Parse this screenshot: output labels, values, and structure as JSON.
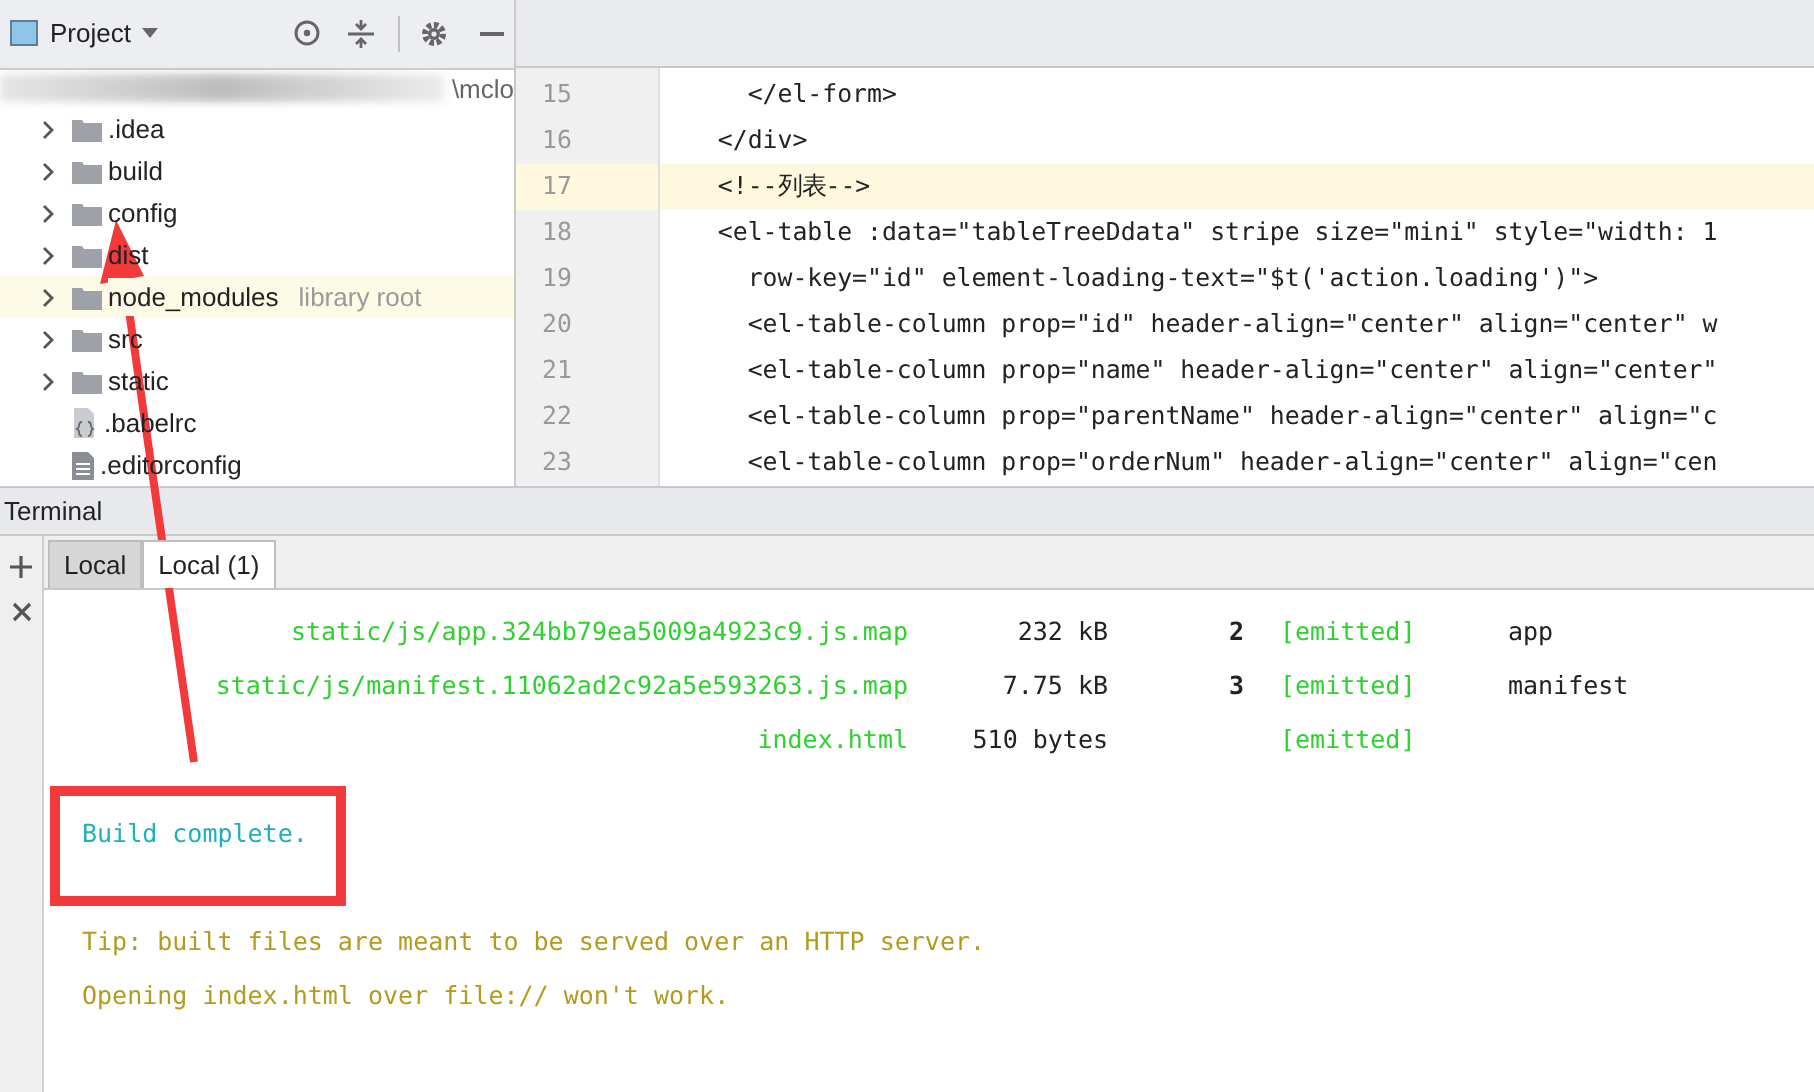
{
  "project_panel": {
    "title": "Project",
    "path_tail": "\\mclo",
    "tree": [
      {
        "label": ".idea",
        "kind": "folder",
        "highlighted": false
      },
      {
        "label": "build",
        "kind": "folder",
        "highlighted": false
      },
      {
        "label": "config",
        "kind": "folder",
        "highlighted": false
      },
      {
        "label": "dist",
        "kind": "folder",
        "highlighted": false
      },
      {
        "label": "node_modules",
        "kind": "folder",
        "hint": "library root",
        "highlighted": true
      },
      {
        "label": "src",
        "kind": "folder",
        "highlighted": false
      },
      {
        "label": "static",
        "kind": "folder",
        "highlighted": false
      },
      {
        "label": ".babelrc",
        "kind": "config-file",
        "highlighted": false
      },
      {
        "label": ".editorconfig",
        "kind": "text-file",
        "highlighted": false
      }
    ]
  },
  "editor": {
    "lines": [
      {
        "number": "15",
        "code": "    </el-form>",
        "highlighted": false
      },
      {
        "number": "16",
        "code": "  </div>",
        "highlighted": false
      },
      {
        "number": "17",
        "code": "  <!--列表-->",
        "highlighted": true
      },
      {
        "number": "18",
        "code": "  <el-table :data=\"tableTreeDdata\" stripe size=\"mini\" style=\"width: 1",
        "highlighted": false
      },
      {
        "number": "19",
        "code": "    row-key=\"id\" element-loading-text=\"$t('action.loading')\">",
        "highlighted": false
      },
      {
        "number": "20",
        "code": "    <el-table-column prop=\"id\" header-align=\"center\" align=\"center\" w",
        "highlighted": false
      },
      {
        "number": "21",
        "code": "    <el-table-column prop=\"name\" header-align=\"center\" align=\"center\"",
        "highlighted": false
      },
      {
        "number": "22",
        "code": "    <el-table-column prop=\"parentName\" header-align=\"center\" align=\"c",
        "highlighted": false
      },
      {
        "number": "23",
        "code": "    <el-table-column prop=\"orderNum\" header-align=\"center\" align=\"cen",
        "highlighted": false
      }
    ]
  },
  "terminal": {
    "title": "Terminal",
    "tabs": [
      {
        "label": "Local",
        "selected": false
      },
      {
        "label": "Local (1)",
        "selected": true
      }
    ],
    "assets": [
      {
        "file": "static/js/app.324bb79ea5009a4923c9.js.map",
        "size": "232 kB",
        "chunks": "2",
        "status": "[emitted]",
        "name": "app"
      },
      {
        "file": "static/js/manifest.11062ad2c92a5e593263.js.map",
        "size": "7.75 kB",
        "chunks": "3",
        "status": "[emitted]",
        "name": "manifest"
      },
      {
        "file": "index.html",
        "size": "510 bytes",
        "status": "[emitted]"
      }
    ],
    "messages": [
      {
        "text": "Build complete.",
        "kind": "success"
      },
      {
        "text": "Tip: built files are meant to be served over an HTTP server.",
        "kind": "tip"
      },
      {
        "text": "Opening index.html over file:// won't work.",
        "kind": "tip"
      }
    ]
  }
}
